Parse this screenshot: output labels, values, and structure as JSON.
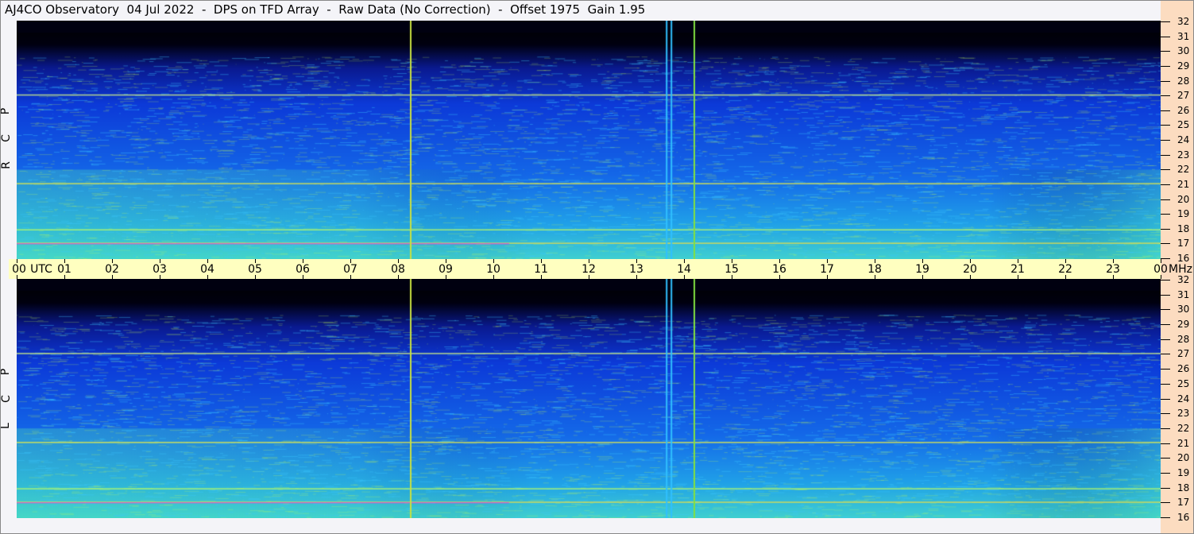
{
  "title": "AJ4CO Observatory  04 Jul 2022  -  DPS on TFD Array  -  Raw Data (No Correction)  -  Offset 1975  Gain 1.95",
  "top_panel": {
    "polarization_letters": [
      "R",
      "C",
      "P"
    ]
  },
  "bottom_panel": {
    "polarization_letters": [
      "L",
      "C",
      "P"
    ]
  },
  "time_axis": {
    "utc_label": "UTC",
    "unit_label": "MHz"
  },
  "chart_data": {
    "type": "heatmap",
    "title": "AJ4CO Observatory 04 Jul 2022 - DPS on TFD Array - Raw Data (No Correction) - Offset 1975 Gain 1.95",
    "xlabel": "UTC",
    "ylabel": "MHz",
    "x_range_hours": [
      0,
      24
    ],
    "y_range_mhz": [
      16,
      32
    ],
    "x_ticks": [
      "00",
      "01",
      "02",
      "03",
      "04",
      "05",
      "06",
      "07",
      "08",
      "09",
      "10",
      "11",
      "12",
      "13",
      "14",
      "15",
      "16",
      "17",
      "18",
      "19",
      "20",
      "21",
      "22",
      "23",
      "00"
    ],
    "y_ticks": [
      "16",
      "17",
      "18",
      "19",
      "20",
      "21",
      "22",
      "23",
      "24",
      "25",
      "26",
      "27",
      "28",
      "29",
      "30",
      "31",
      "32"
    ],
    "panels": [
      "RCP",
      "LCP"
    ],
    "interference_lines_mhz": [
      17.1,
      18.0,
      21.1,
      27.05
    ],
    "vertical_markers_utc": [
      {
        "t": 8.25,
        "color": "#c8e040"
      },
      {
        "t": 13.62,
        "color": "#30c0ff"
      },
      {
        "t": 13.72,
        "color": "#30c0ff"
      },
      {
        "t": 14.2,
        "color": "#80e040"
      }
    ],
    "colors": {
      "low": "#000000",
      "mid": "#1030d0",
      "high": "#30e0e0",
      "peak": "#f0ff40"
    }
  }
}
